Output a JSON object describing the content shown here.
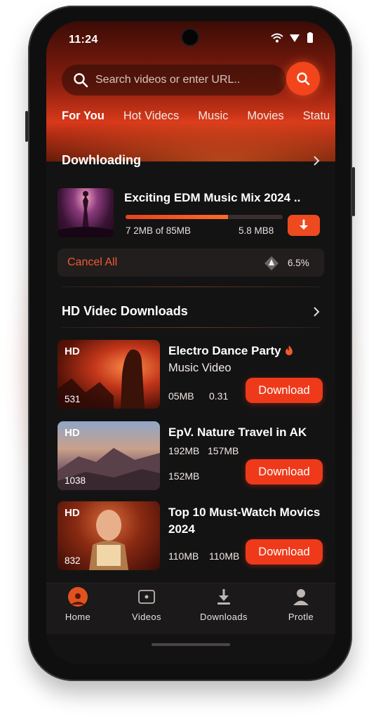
{
  "status_bar": {
    "time": "11:24"
  },
  "search": {
    "placeholder": "Search videos or enter URL..",
    "button_icon": "search-icon"
  },
  "tabs": [
    {
      "label": "For You",
      "active": true
    },
    {
      "label": "Hot Videcs"
    },
    {
      "label": "Music"
    },
    {
      "label": "Movies"
    },
    {
      "label": "Statu"
    }
  ],
  "downloading": {
    "title": "Dowhloading",
    "item": {
      "title": "Exciting EDM Music Mix 2024 ..",
      "progress_fraction": 0.65,
      "size_progress": "7 2MB of 85MB",
      "speed": "5.8 MB8"
    },
    "cancel_label": "Cancel All",
    "percent": "6.5%"
  },
  "hd": {
    "title": "HD Videc Downloads",
    "items": [
      {
        "badge": "HD",
        "views": "531",
        "title": "Electro Dance Party",
        "subtitle": "Music Video",
        "meta1": "05MB",
        "meta2": "0.31",
        "button": "Download"
      },
      {
        "badge": "HD",
        "views": "1038",
        "title": "EpV. Nature Travel in AK",
        "meta1": "192MB",
        "meta2": "157MB",
        "meta3": "152MB",
        "button": "Download"
      },
      {
        "badge": "HD",
        "views": "832",
        "title": "Top 10 Must-Watch Movics 2024",
        "meta1": "110MB",
        "meta2": "110MB",
        "button": "Download"
      }
    ]
  },
  "nav": [
    {
      "label": "Home",
      "icon": "home-icon",
      "active": true
    },
    {
      "label": "Videos",
      "icon": "video-icon"
    },
    {
      "label": "Downloads",
      "icon": "download-icon"
    },
    {
      "label": "Protle",
      "icon": "profile-icon"
    }
  ],
  "colors": {
    "accent": "#ee3a1a",
    "background": "#141313"
  }
}
